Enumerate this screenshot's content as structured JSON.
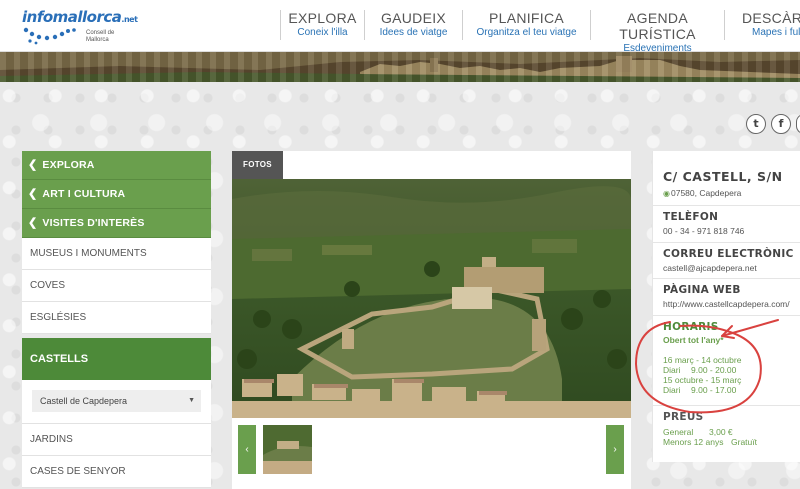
{
  "header": {
    "logo": {
      "text_main": "infomallorca",
      "text_tld": ".net",
      "sub_line1": "Consell de",
      "sub_line2": "Mallorca"
    },
    "nav": [
      {
        "title": "EXPLORA",
        "sub": "Coneix l'illa"
      },
      {
        "title": "GAUDEIX",
        "sub": "Idees de viatge"
      },
      {
        "title": "PLANIFICA",
        "sub": "Organitza el teu viatge"
      },
      {
        "title": "AGENDA TURÍSTICA",
        "sub": "Esdeveniments"
      },
      {
        "title": "DESCÀRREG",
        "sub": "Mapes i full"
      }
    ]
  },
  "social": {
    "twitter": "t",
    "facebook": "f"
  },
  "sidebar": {
    "breadcrumb": [
      {
        "label": "EXPLORA"
      },
      {
        "label": "ART I CULTURA"
      },
      {
        "label": "VISITES D'INTERÈS"
      }
    ],
    "items_top": [
      {
        "label": "MUSEUS I MONUMENTS"
      },
      {
        "label": "COVES"
      },
      {
        "label": "ESGLÉSIES"
      }
    ],
    "active": "CASTELLS",
    "select_value": "Castell de Capdepera",
    "items_bottom": [
      {
        "label": "JARDINS"
      },
      {
        "label": "CASES DE SENYOR"
      }
    ]
  },
  "photos": {
    "tab_label": "FOTOS",
    "prev": "‹",
    "next": "›"
  },
  "info": {
    "address": "C/ CASTELL, S/N",
    "postal": "07580, Capdepera",
    "phone_label": "TELÈFON",
    "phone": "00 - 34 - 971 818 746",
    "email_label": "CORREU ELECTRÒNIC",
    "email": "castell@ajcapdepera.net",
    "web_label": "PÀGINA WEB",
    "web": "http://www.castellcapdepera.com/",
    "hours_label": "HORARIS",
    "hours_sub": "Obert tot l'any*",
    "period1": "16 març - 14 octubre",
    "period1_day": "Diari",
    "period1_time": "9.00 - 20.00",
    "period2": "15 octubre - 15 març",
    "period2_day": "Diari",
    "period2_time": "9.00 - 17.00",
    "prices_label": "PREUS",
    "price1_label": "General",
    "price1_value": "3,00 €",
    "price2_label": "Menors 12 anys",
    "price2_value": "Gratuït"
  },
  "colors": {
    "green": "#6a9f4d",
    "dark_green": "#4d8a39",
    "blue": "#2a73b5",
    "annotation_red": "#d9423f"
  }
}
